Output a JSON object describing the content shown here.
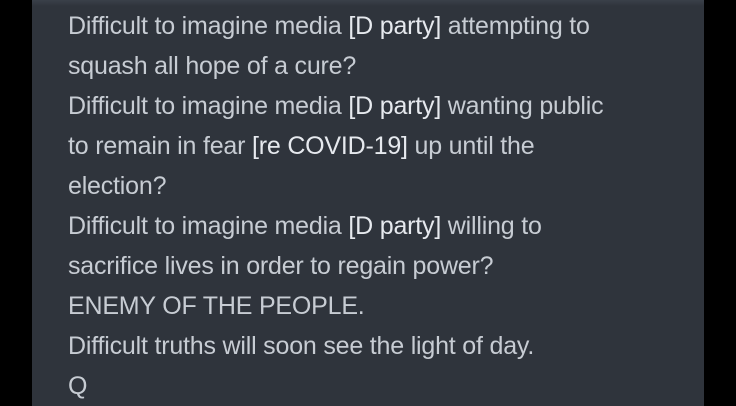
{
  "post": {
    "lines": [
      {
        "pre": "Difficult to imagine media ",
        "tag": "[D party]",
        "post": " attempting to"
      },
      {
        "pre": "squash all hope of a cure?",
        "tag": "",
        "post": ""
      },
      {
        "pre": "Difficult to imagine media ",
        "tag": "[D party]",
        "post": " wanting public"
      },
      {
        "pre": "to remain in fear ",
        "tag": "[re COVID-19]",
        "post": " up until the"
      },
      {
        "pre": "election?",
        "tag": "",
        "post": ""
      },
      {
        "pre": "Difficult to imagine media ",
        "tag": "[D party]",
        "post": " willing to"
      },
      {
        "pre": "sacrifice lives in order to regain power?",
        "tag": "",
        "post": ""
      },
      {
        "pre": "ENEMY OF THE PEOPLE.",
        "tag": "",
        "post": ""
      },
      {
        "pre": "Difficult truths will soon see the light of day.",
        "tag": "",
        "post": ""
      },
      {
        "pre": "Q",
        "tag": "",
        "post": ""
      }
    ]
  },
  "colors": {
    "background": "#000000",
    "panel": "#2f343c",
    "text": "#c7ccd3",
    "tag_text": "#e6e9ee"
  }
}
